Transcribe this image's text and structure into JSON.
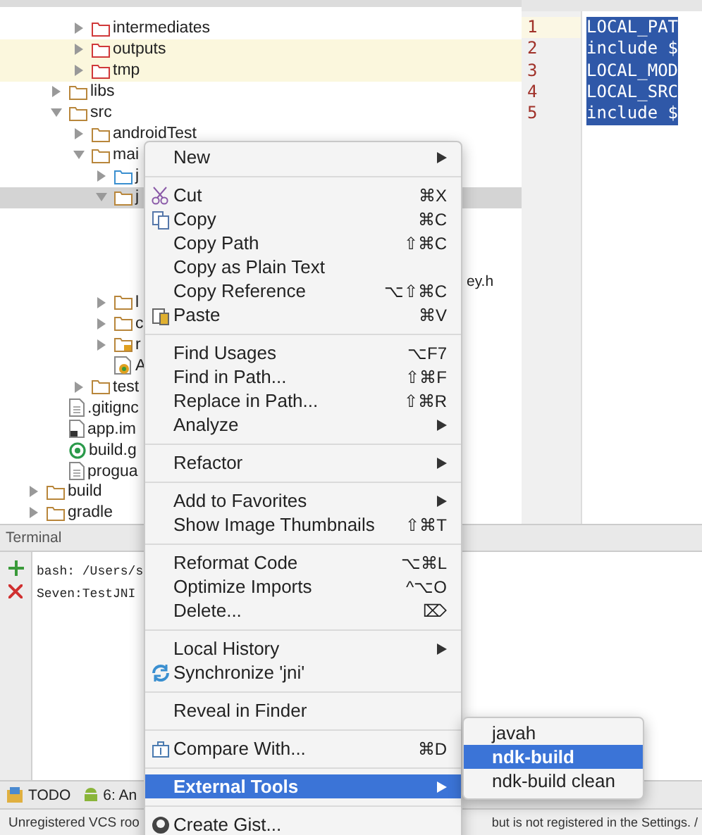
{
  "tree": [
    {
      "children": [
        {
          "children": [
            {
              "label": "intermediates",
              "kind": "excluded",
              "expanded": false,
              "selected": false,
              "highlighted": false
            },
            {
              "label": "outputs",
              "kind": "excluded",
              "expanded": false,
              "selected": false,
              "highlighted": true
            },
            {
              "label": "tmp",
              "kind": "excluded",
              "expanded": false,
              "selected": false,
              "highlighted": true
            }
          ]
        },
        {
          "label": "libs",
          "kind": "folder",
          "expanded": false,
          "selected": false,
          "highlighted": false
        },
        {
          "label": "src",
          "kind": "folder",
          "expanded": true,
          "selected": false,
          "highlighted": false,
          "children": [
            {
              "label": "androidTest",
              "kind": "folder",
              "expanded": false,
              "selected": false,
              "highlighted": false
            },
            {
              "label": "mai",
              "kind": "folder",
              "expanded": true,
              "selected": false,
              "highlighted": false,
              "children": [
                {
                  "label": "j",
                  "kind": "source",
                  "expanded": false,
                  "selected": false,
                  "highlighted": false
                },
                {
                  "label": "j",
                  "kind": "folder",
                  "expanded": true,
                  "selected": true,
                  "highlighted": false,
                  "children": [
                    {
                      "label": "ey.h",
                      "kind": "clipped",
                      "selected": false,
                      "highlighted": false
                    }
                  ]
                },
                {
                  "label": "l",
                  "kind": "folder",
                  "expanded": false,
                  "selected": false,
                  "highlighted": false
                },
                {
                  "label": "c",
                  "kind": "folder",
                  "expanded": false,
                  "selected": false,
                  "highlighted": false
                },
                {
                  "label": "r",
                  "kind": "resources",
                  "expanded": false,
                  "selected": false,
                  "highlighted": false
                },
                {
                  "label": "A",
                  "kind": "manifest",
                  "selected": false,
                  "highlighted": false
                }
              ]
            },
            {
              "label": "test",
              "kind": "folder",
              "expanded": false,
              "selected": false,
              "highlighted": false
            }
          ]
        },
        {
          "label": ".gitignc",
          "kind": "file",
          "selected": false,
          "highlighted": false
        },
        {
          "label": "app.im",
          "kind": "module",
          "selected": false,
          "highlighted": false
        },
        {
          "label": "build.g",
          "kind": "gradle",
          "selected": false,
          "highlighted": false
        },
        {
          "label": "progua",
          "kind": "file",
          "selected": false,
          "highlighted": false
        }
      ]
    },
    {
      "label": "build",
      "kind": "folder",
      "expanded": false,
      "selected": false,
      "highlighted": false
    },
    {
      "label": "gradle",
      "kind": "folder",
      "expanded": false,
      "selected": false,
      "highlighted": false
    }
  ],
  "editor": {
    "lines": [
      {
        "number": "1",
        "text": "LOCAL_PAT",
        "selected": true,
        "current": true
      },
      {
        "number": "2",
        "text": "include $",
        "selected": true,
        "current": false
      },
      {
        "number": "3",
        "text": "LOCAL_MOD",
        "selected": true,
        "current": false
      },
      {
        "number": "4",
        "text": "LOCAL_SRC",
        "selected": true,
        "current": false
      },
      {
        "number": "5",
        "text": "include $",
        "selected": true,
        "current": false
      }
    ]
  },
  "terminal": {
    "title": "Terminal",
    "lines": [
      "bash: /Users/s",
      "Seven:TestJNI"
    ]
  },
  "tool_tabs": [
    {
      "label": "TODO",
      "kind": "todo"
    },
    {
      "label": "6: An",
      "kind": "android"
    }
  ],
  "status_bar": {
    "left": "Unregistered VCS roo",
    "right": "but is not registered in the Settings. /"
  },
  "context_menu": [
    {
      "kind": "item",
      "label": "New",
      "submenu": true,
      "selected": false
    },
    {
      "kind": "separator"
    },
    {
      "kind": "item",
      "label": "Cut",
      "shortcut": "⌘X",
      "selected": false
    },
    {
      "kind": "item",
      "label": "Copy",
      "shortcut": "⌘C",
      "selected": false
    },
    {
      "kind": "item",
      "label": "Copy Path",
      "shortcut": "⇧⌘C",
      "selected": false
    },
    {
      "kind": "item",
      "label": "Copy as Plain Text",
      "selected": false
    },
    {
      "kind": "item",
      "label": "Copy Reference",
      "shortcut": "⌥⇧⌘C",
      "selected": false
    },
    {
      "kind": "item",
      "label": "Paste",
      "shortcut": "⌘V",
      "selected": false
    },
    {
      "kind": "separator"
    },
    {
      "kind": "item",
      "label": "Find Usages",
      "shortcut": "⌥F7",
      "selected": false
    },
    {
      "kind": "item",
      "label": "Find in Path...",
      "shortcut": "⇧⌘F",
      "selected": false
    },
    {
      "kind": "item",
      "label": "Replace in Path...",
      "shortcut": "⇧⌘R",
      "selected": false
    },
    {
      "kind": "item",
      "label": "Analyze",
      "submenu": true,
      "selected": false
    },
    {
      "kind": "separator"
    },
    {
      "kind": "item",
      "label": "Refactor",
      "submenu": true,
      "selected": false
    },
    {
      "kind": "separator"
    },
    {
      "kind": "item",
      "label": "Add to Favorites",
      "submenu": true,
      "selected": false
    },
    {
      "kind": "item",
      "label": "Show Image Thumbnails",
      "shortcut": "⇧⌘T",
      "selected": false
    },
    {
      "kind": "separator"
    },
    {
      "kind": "item",
      "label": "Reformat Code",
      "shortcut": "⌥⌘L",
      "selected": false
    },
    {
      "kind": "item",
      "label": "Optimize Imports",
      "shortcut": "^⌥O",
      "selected": false
    },
    {
      "kind": "item",
      "label": "Delete...",
      "shortcut": "⌦",
      "selected": false
    },
    {
      "kind": "separator"
    },
    {
      "kind": "item",
      "label": "Local History",
      "submenu": true,
      "selected": false
    },
    {
      "kind": "item",
      "label": "Synchronize 'jni'",
      "selected": false
    },
    {
      "kind": "separator"
    },
    {
      "kind": "item",
      "label": "Reveal in Finder",
      "selected": false
    },
    {
      "kind": "separator"
    },
    {
      "kind": "item",
      "label": "Compare With...",
      "shortcut": "⌘D",
      "selected": false
    },
    {
      "kind": "separator"
    },
    {
      "kind": "item",
      "label": "External Tools",
      "submenu": true,
      "selected": true
    },
    {
      "kind": "separator"
    },
    {
      "kind": "item",
      "label": "Create Gist...",
      "selected": false
    }
  ],
  "submenu": [
    {
      "label": "javah",
      "selected": false
    },
    {
      "label": "ndk-build",
      "selected": true
    },
    {
      "label": "ndk-build clean",
      "selected": false
    }
  ]
}
